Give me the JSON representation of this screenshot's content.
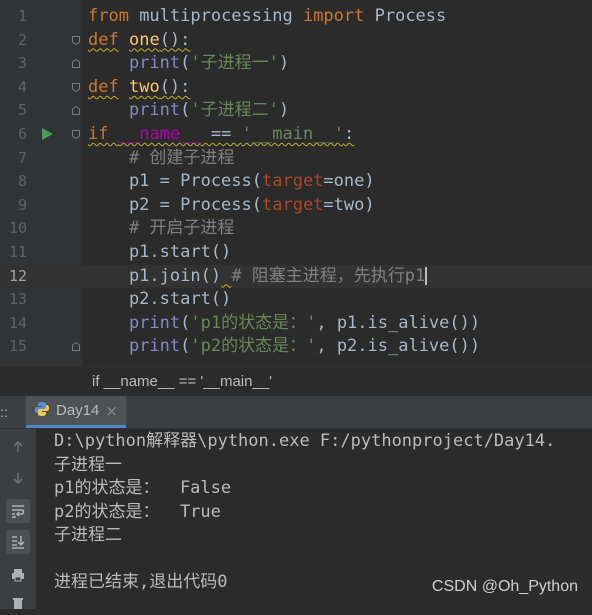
{
  "editor": {
    "current_line": 12,
    "lines": [
      {
        "n": "1",
        "tokens": [
          {
            "t": "from",
            "c": "kw"
          },
          {
            "t": " multiprocessing "
          },
          {
            "t": "import",
            "c": "kw"
          },
          {
            "t": " Process"
          }
        ]
      },
      {
        "n": "2",
        "tokens": [
          {
            "t": "def",
            "c": "kw warn"
          },
          {
            "t": " "
          },
          {
            "t": "one",
            "c": "fn warn"
          },
          {
            "t": "():",
            "c": "warn"
          }
        ]
      },
      {
        "n": "3",
        "tokens": [
          {
            "t": "    "
          },
          {
            "t": "print",
            "c": "builtin"
          },
          {
            "t": "("
          },
          {
            "t": "'子进程一'",
            "c": "str"
          },
          {
            "t": ")"
          }
        ]
      },
      {
        "n": "4",
        "tokens": [
          {
            "t": "def",
            "c": "kw warn"
          },
          {
            "t": " "
          },
          {
            "t": "two",
            "c": "fn warn"
          },
          {
            "t": "():",
            "c": "warn"
          }
        ]
      },
      {
        "n": "5",
        "tokens": [
          {
            "t": "    "
          },
          {
            "t": "print",
            "c": "builtin"
          },
          {
            "t": "("
          },
          {
            "t": "'子进程二'",
            "c": "str"
          },
          {
            "t": ")"
          }
        ]
      },
      {
        "n": "6",
        "tokens": [
          {
            "t": "if",
            "c": "kw warn"
          },
          {
            "t": " ",
            "c": "warn"
          },
          {
            "t": "__name__",
            "c": "dunder warn"
          },
          {
            "t": " == ",
            "c": "warn"
          },
          {
            "t": "'__main__'",
            "c": "str warn"
          },
          {
            "t": ":",
            "c": "warn"
          }
        ]
      },
      {
        "n": "7",
        "tokens": [
          {
            "t": "    "
          },
          {
            "t": "# 创建子进程",
            "c": "cmt"
          }
        ]
      },
      {
        "n": "8",
        "tokens": [
          {
            "t": "    p1 = Process("
          },
          {
            "t": "target",
            "c": "param"
          },
          {
            "t": "=one)"
          }
        ]
      },
      {
        "n": "9",
        "tokens": [
          {
            "t": "    p2 = Process("
          },
          {
            "t": "target",
            "c": "param"
          },
          {
            "t": "=two)"
          }
        ]
      },
      {
        "n": "10",
        "tokens": [
          {
            "t": "    "
          },
          {
            "t": "# 开启子进程",
            "c": "cmt"
          }
        ]
      },
      {
        "n": "11",
        "tokens": [
          {
            "t": "    p1.start()"
          }
        ]
      },
      {
        "n": "12",
        "tokens": [
          {
            "t": "    p1.join()"
          },
          {
            "t": " ",
            "c": "warn"
          },
          {
            "t": "# 阻塞主进程，先执行p1",
            "c": "cmt"
          }
        ]
      },
      {
        "n": "13",
        "tokens": [
          {
            "t": "    p2.start()"
          }
        ]
      },
      {
        "n": "14",
        "tokens": [
          {
            "t": "    "
          },
          {
            "t": "print",
            "c": "builtin"
          },
          {
            "t": "("
          },
          {
            "t": "'p1的状态是：'",
            "c": "str"
          },
          {
            "t": ", p1.is_alive())"
          }
        ]
      },
      {
        "n": "15",
        "tokens": [
          {
            "t": "    "
          },
          {
            "t": "print",
            "c": "builtin"
          },
          {
            "t": "("
          },
          {
            "t": "'p2的状态是：'",
            "c": "str"
          },
          {
            "t": ", p2.is_alive())"
          }
        ]
      }
    ]
  },
  "breadcrumb": {
    "text": "if __name__ == '__main__'"
  },
  "run_panel": {
    "edge_label": "::",
    "tab_label": "Day14",
    "tab_close": "×",
    "tools": [
      {
        "name": "up-arrow-icon"
      },
      {
        "name": "down-arrow-icon"
      },
      {
        "name": "soft-wrap-icon"
      },
      {
        "name": "scroll-to-end-icon"
      },
      {
        "name": "print-icon"
      },
      {
        "name": "trash-icon"
      }
    ],
    "console_lines": [
      "D:\\python解释器\\python.exe F:/pythonproject/Day14.",
      "子进程一",
      "p1的状态是：  False",
      "p2的状态是：  True",
      "子进程二",
      "",
      "进程已结束,退出代码0"
    ]
  },
  "watermark": "CSDN @Oh_Python",
  "colors": {
    "keyword": "#cc7832",
    "function": "#ffc66d",
    "string": "#6a8759",
    "comment": "#808080",
    "param": "#aa4926",
    "builtin": "#8888c6",
    "dunder": "#b200b2",
    "run_arrow": "#499c54"
  }
}
